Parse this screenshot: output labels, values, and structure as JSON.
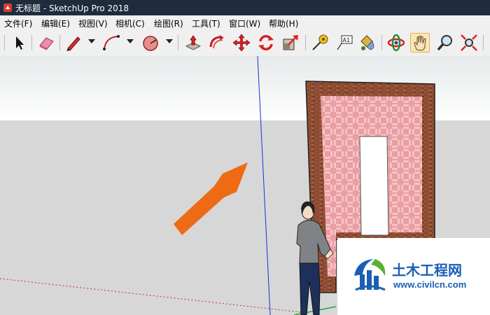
{
  "window": {
    "title": "无标题 - SketchUp Pro 2018"
  },
  "menu": [
    "文件(F)",
    "编辑(E)",
    "视图(V)",
    "相机(C)",
    "绘图(R)",
    "工具(T)",
    "窗口(W)",
    "帮助(H)"
  ],
  "toolbar": {
    "tools": [
      {
        "icon": "select-arrow-icon"
      },
      {
        "icon": "eraser-icon"
      },
      {
        "icon": "pencil-line-icon"
      },
      {
        "icon": "arc-icon"
      },
      {
        "icon": "polygon-shape-icon"
      },
      {
        "icon": "push-pull-icon"
      },
      {
        "icon": "follow-me-icon"
      },
      {
        "icon": "move-icon"
      },
      {
        "icon": "rotate-icon"
      },
      {
        "icon": "scale-icon"
      },
      {
        "icon": "tape-measure-icon"
      },
      {
        "icon": "text-label-icon",
        "text": "A1"
      },
      {
        "icon": "paint-bucket-icon"
      },
      {
        "icon": "orbit-icon"
      },
      {
        "icon": "pan-hand-icon",
        "active": true
      },
      {
        "icon": "zoom-icon"
      },
      {
        "icon": "zoom-extents-icon"
      }
    ]
  },
  "watermark": {
    "title": "土木工程网",
    "url": "www.civilcn.com"
  },
  "colors": {
    "titlebar": "#1f2c3d",
    "brick": "#8a4b32",
    "pink_wall": "#e8a0a4",
    "arrow": "#ee6a14",
    "watermark_blue": "#1a5fb4"
  }
}
